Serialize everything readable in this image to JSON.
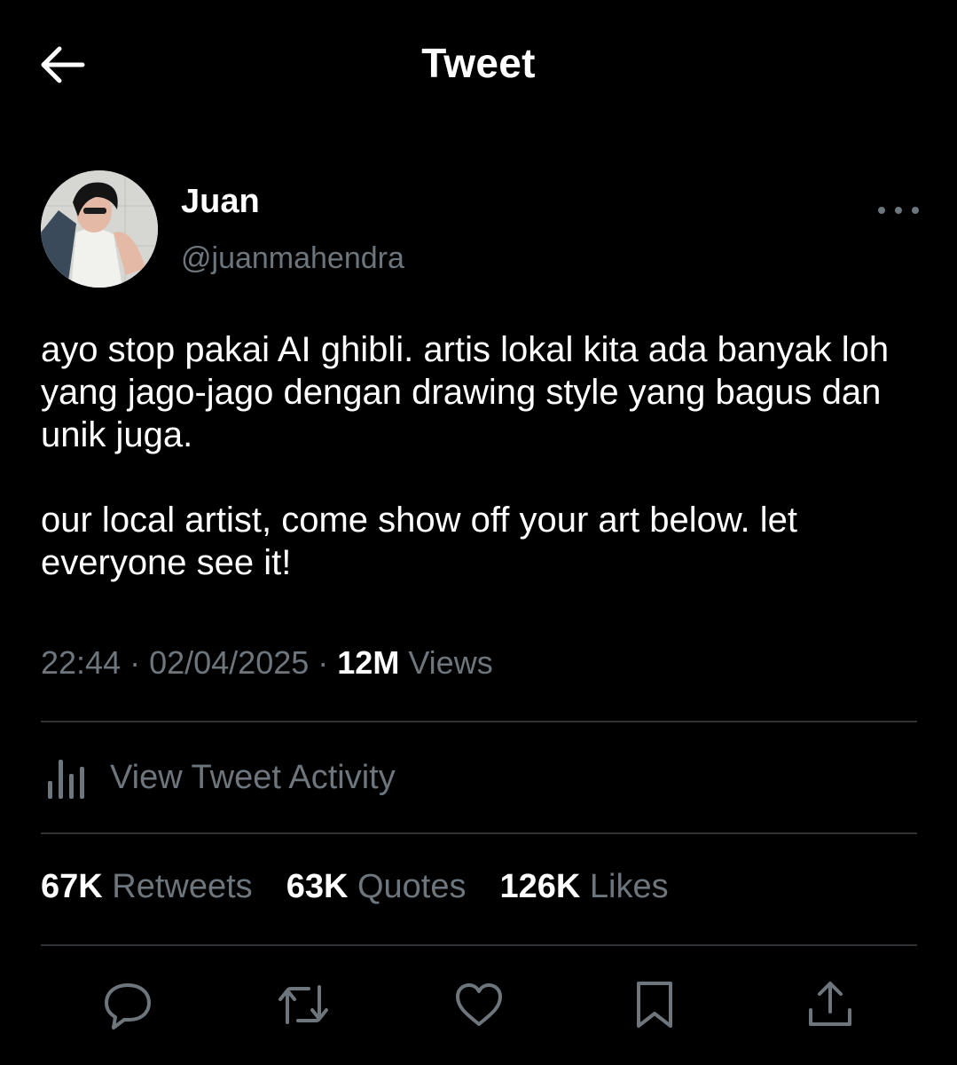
{
  "header": {
    "title": "Tweet"
  },
  "author": {
    "display_name": "Juan",
    "handle": "@juanmahendra"
  },
  "tweet": {
    "paragraphs": [
      "ayo stop pakai AI ghibli. artis lokal kita ada banyak loh yang jago-jago dengan drawing style yang bagus dan unik juga.",
      "our local artist, come show off your art below. let everyone see it!"
    ],
    "time": "22:44",
    "separator": " · ",
    "date": "02/04/2025",
    "views_count": "12M",
    "views_label": " Views"
  },
  "activity": {
    "label": "View Tweet Activity"
  },
  "stats": {
    "retweets": {
      "count": "67K",
      "label": " Retweets"
    },
    "quotes": {
      "count": "63K",
      "label": " Quotes"
    },
    "likes": {
      "count": "126K",
      "label": " Likes"
    }
  },
  "actions": {
    "icons": [
      "reply-icon",
      "retweet-icon",
      "like-icon",
      "bookmark-icon",
      "share-icon"
    ]
  },
  "colors": {
    "background": "#000000",
    "primary_text": "#ffffff",
    "secondary_text": "#6e767d",
    "divider": "#2f3336"
  }
}
